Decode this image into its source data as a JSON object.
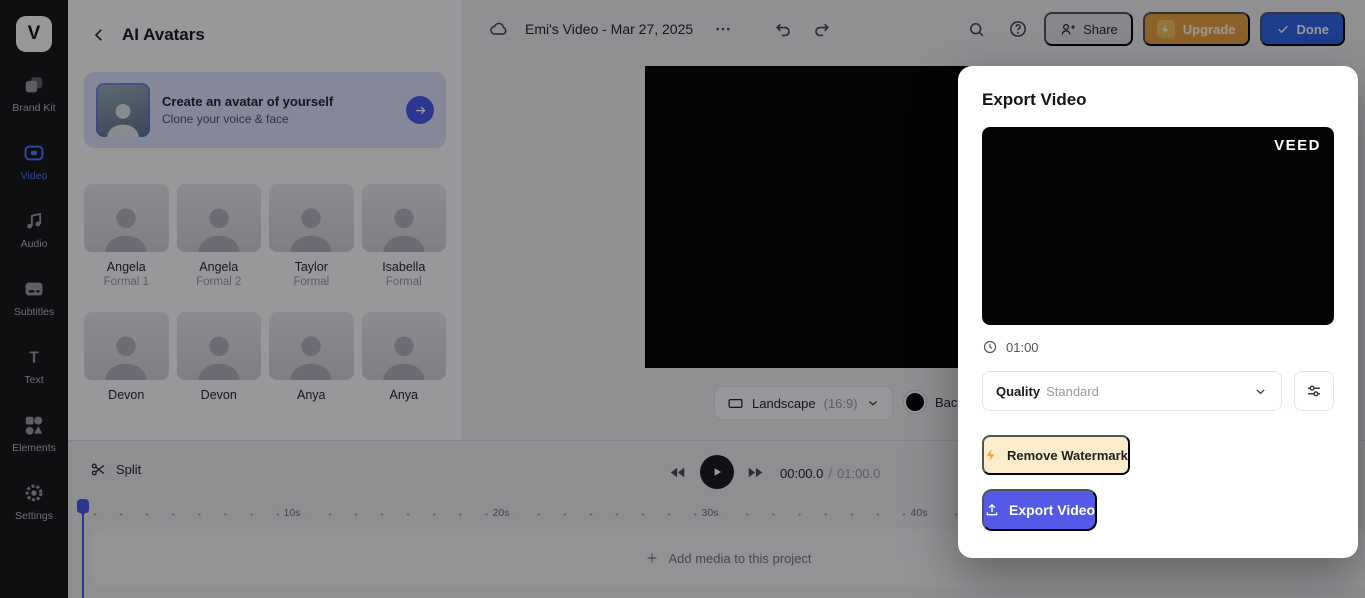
{
  "sidebar": {
    "logo_text": "V",
    "items": [
      {
        "label": "Brand Kit",
        "icon": "brand-kit-icon"
      },
      {
        "label": "Video",
        "icon": "video-icon",
        "active": true
      },
      {
        "label": "Audio",
        "icon": "audio-icon"
      },
      {
        "label": "Subtitles",
        "icon": "subtitles-icon"
      },
      {
        "label": "Text",
        "icon": "text-icon"
      },
      {
        "label": "Elements",
        "icon": "elements-icon"
      },
      {
        "label": "Settings",
        "icon": "settings-icon"
      }
    ]
  },
  "panel": {
    "title": "AI Avatars",
    "banner": {
      "title": "Create an avatar of yourself",
      "subtitle": "Clone your voice & face"
    },
    "avatars": [
      {
        "name": "Angela",
        "style": "Formal 1"
      },
      {
        "name": "Angela",
        "style": "Formal 2"
      },
      {
        "name": "Taylor",
        "style": "Formal"
      },
      {
        "name": "Isabella",
        "style": "Formal"
      },
      {
        "name": "Devon",
        "style": ""
      },
      {
        "name": "Devon",
        "style": ""
      },
      {
        "name": "Anya",
        "style": ""
      },
      {
        "name": "Anya",
        "style": ""
      }
    ]
  },
  "header": {
    "title": "Emi's Video - Mar 27, 2025",
    "share_label": "Share",
    "upgrade_label": "Upgrade",
    "done_label": "Done"
  },
  "canvas": {
    "layout_label": "Landscape",
    "layout_ratio": "(16:9)",
    "background_label": "Background"
  },
  "timeline": {
    "split_label": "Split",
    "current_time": "00:00.0",
    "separator": "/",
    "total_time": "01:00.0",
    "markers": [
      "10s",
      "20s",
      "30s",
      "40s"
    ],
    "add_media_label": "Add media to this project"
  },
  "modal": {
    "title": "Export Video",
    "watermark": "VEED",
    "duration": "01:00",
    "quality_label": "Quality",
    "quality_value": "Standard",
    "remove_watermark_label": "Remove Watermark",
    "export_label": "Export Video"
  },
  "colors": {
    "accent_purple": "#5559e8",
    "done_blue": "#2b63e9",
    "upgrade_orange": "#eca33d",
    "watermark_button_bg": "#fcedca",
    "playhead_blue": "#4656ee",
    "rail_bg": "#141416"
  }
}
